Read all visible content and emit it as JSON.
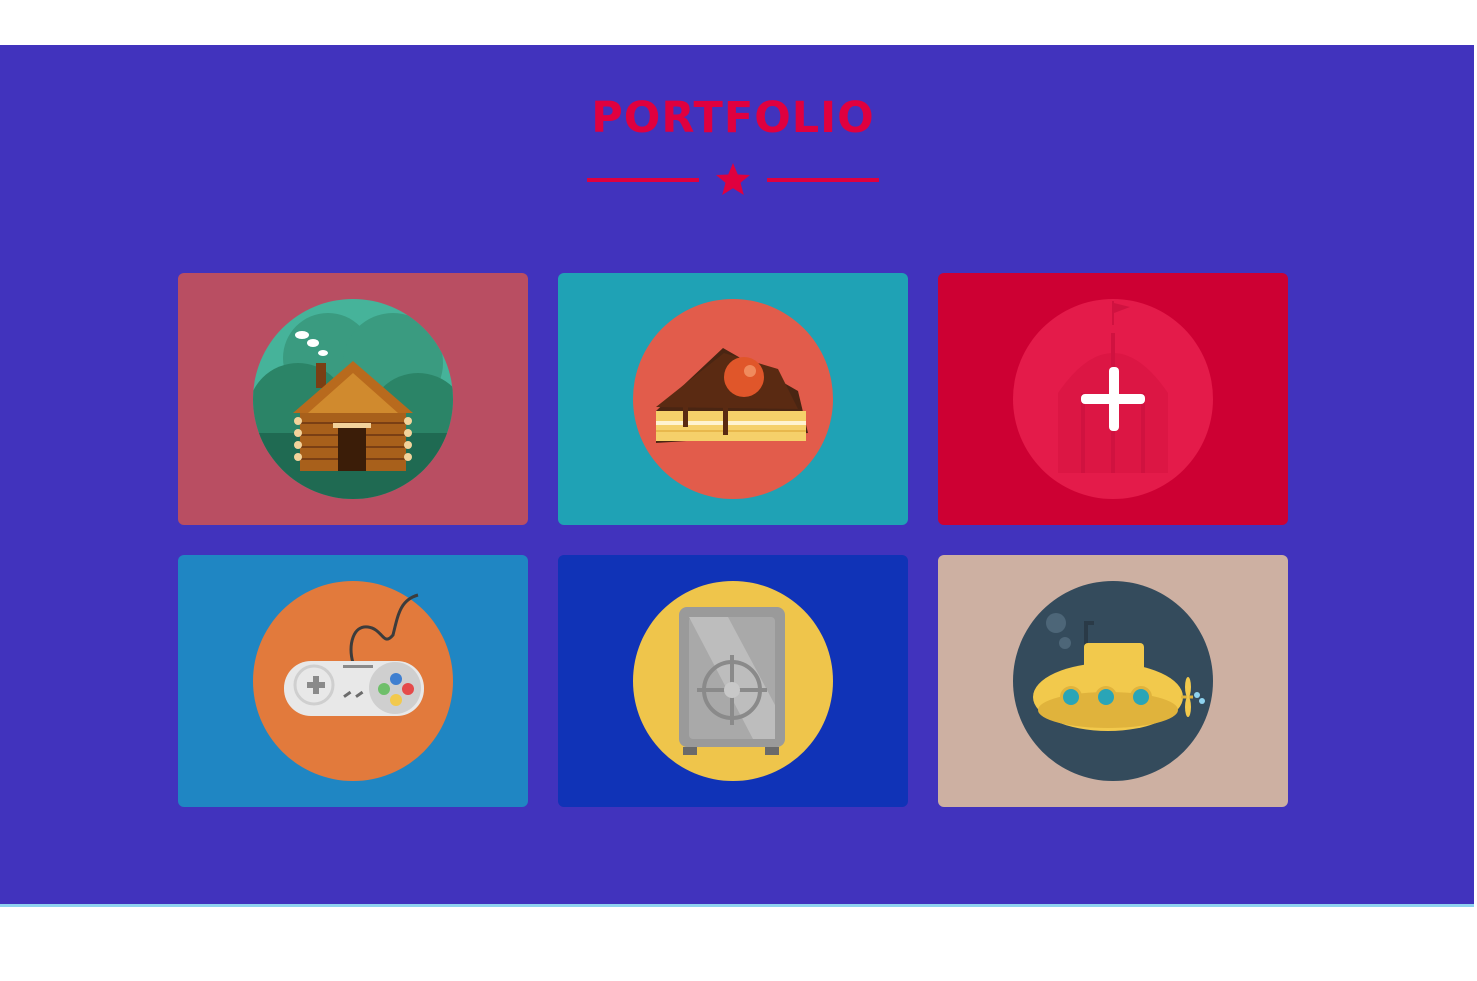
{
  "portfolio": {
    "title": "PORTFOLIO",
    "colors": {
      "section_bg": "#4133bd",
      "accent": "#e0003f",
      "bottom_line": "#8fd3ef"
    },
    "divider_icon": "star-icon",
    "items": [
      {
        "icon": "log-cabin-icon",
        "bg": "#b94e62",
        "circle": "#2b8a6a",
        "hovered": false
      },
      {
        "icon": "cake-slice-icon",
        "bg": "#1fa2b5",
        "circle": "#e25c4b",
        "hovered": false
      },
      {
        "icon": "circus-tent-icon",
        "bg": "#cd0033",
        "circle": "#e41b4a",
        "hovered": true,
        "overlay_icon": "plus-icon"
      },
      {
        "icon": "game-controller-icon",
        "bg": "#1f86c3",
        "circle": "#e27a3c",
        "hovered": false
      },
      {
        "icon": "safe-icon",
        "bg": "#1033b7",
        "circle": "#efc54b",
        "hovered": false
      },
      {
        "icon": "submarine-icon",
        "bg": "#cdb0a2",
        "circle": "#344b5c",
        "hovered": false
      }
    ]
  }
}
